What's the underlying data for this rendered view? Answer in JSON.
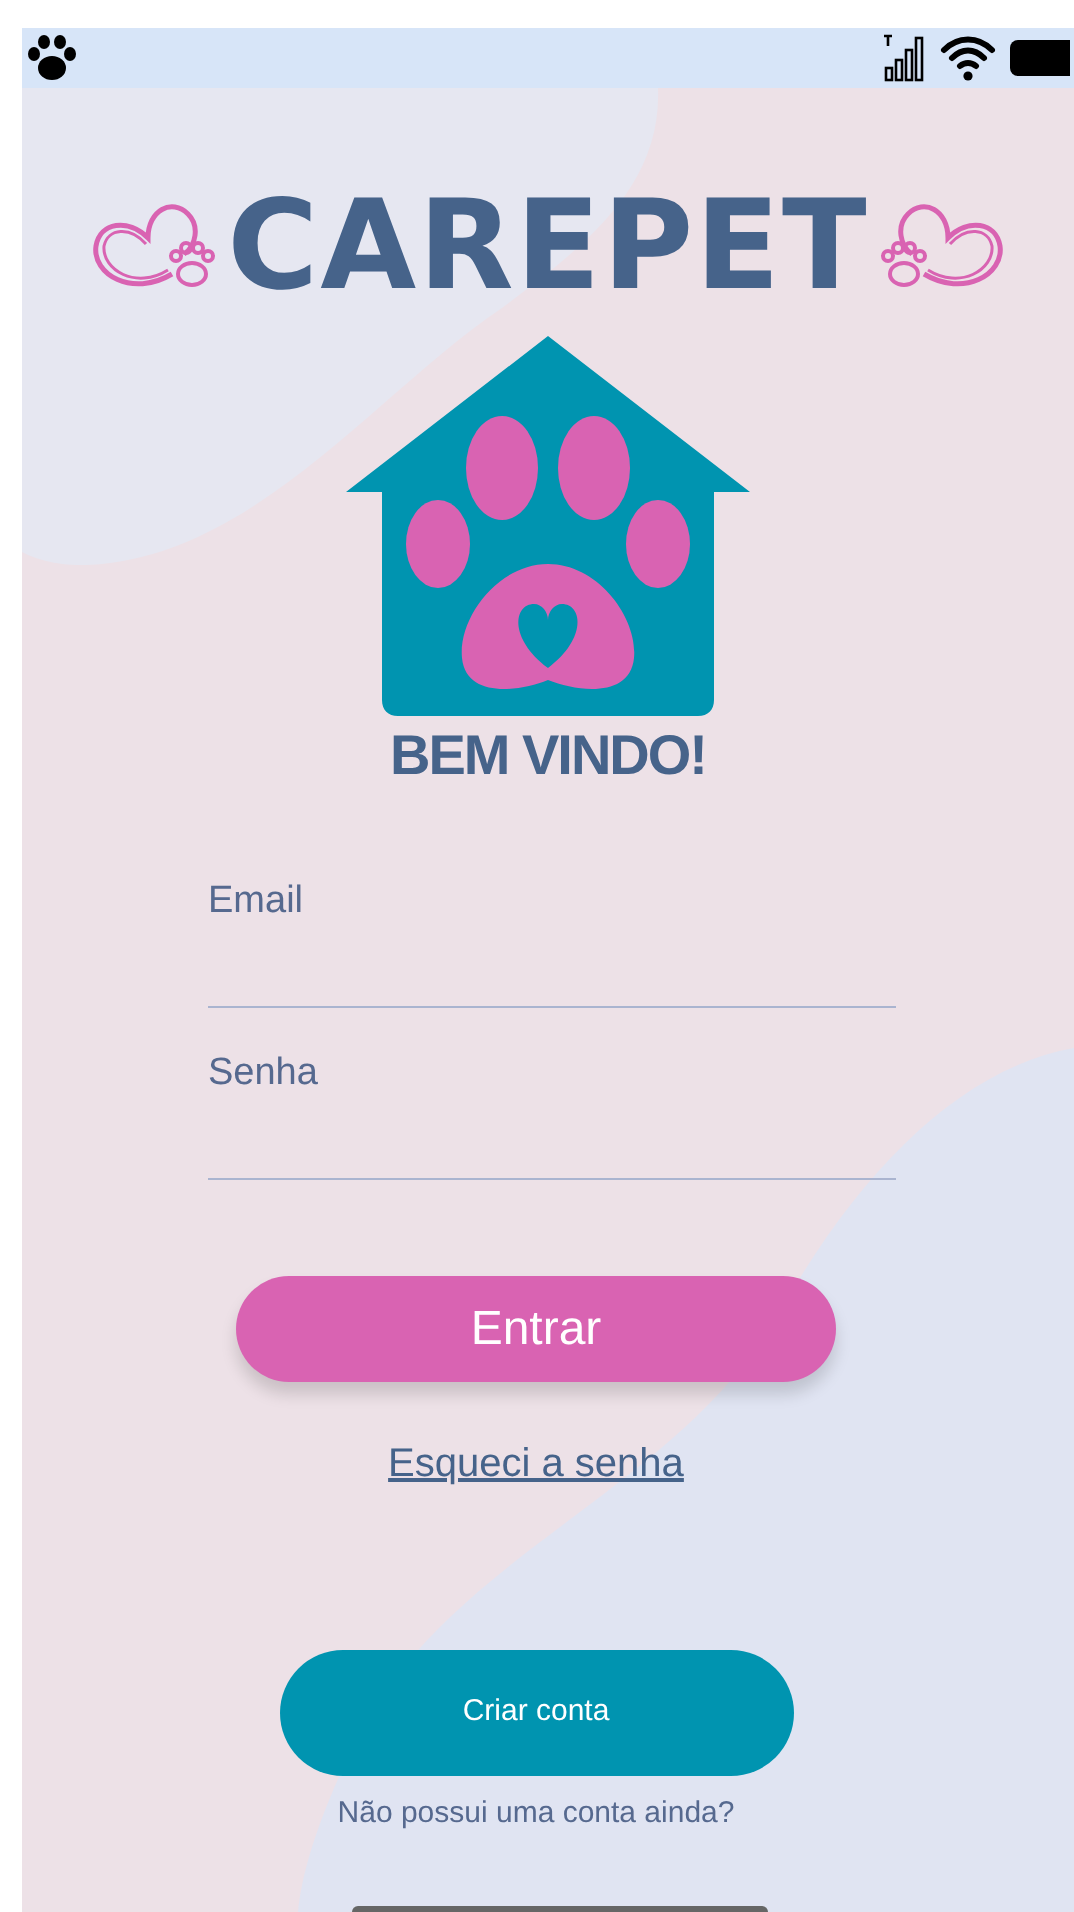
{
  "app_title": "CAREPET",
  "welcome": "BEM VINDO!",
  "fields": [
    {
      "placeholder": "Email"
    },
    {
      "placeholder": "Senha"
    }
  ],
  "login_button": "Entrar",
  "forgot_link": "Esqueci a senha",
  "create_button": "Criar conta",
  "signup_prompt": "Não possui uma conta ainda?"
}
